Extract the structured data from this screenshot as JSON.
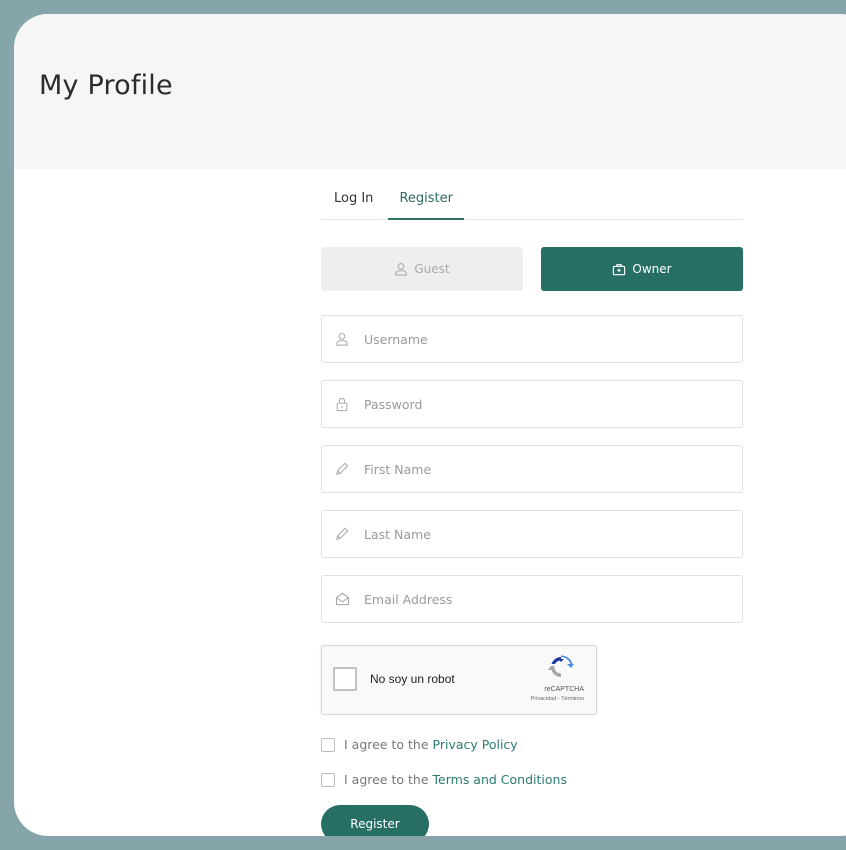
{
  "header": {
    "title": "My Profile"
  },
  "tabs": [
    {
      "label": "Log In",
      "active": false
    },
    {
      "label": "Register",
      "active": true
    }
  ],
  "roles": {
    "guest": {
      "label": "Guest",
      "icon": "user-icon"
    },
    "owner": {
      "label": "Owner",
      "icon": "briefcase-icon",
      "selected": true
    }
  },
  "fields": {
    "username": {
      "placeholder": "Username",
      "icon": "user-icon"
    },
    "password": {
      "placeholder": "Password",
      "icon": "lock-icon"
    },
    "first_name": {
      "placeholder": "First Name",
      "icon": "pencil-icon"
    },
    "last_name": {
      "placeholder": "Last Name",
      "icon": "pencil-icon"
    },
    "email": {
      "placeholder": "Email Address",
      "icon": "envelope-icon"
    }
  },
  "captcha": {
    "label": "No soy un robot",
    "brand": "reCAPTCHA",
    "links": "Privacidad - Términos"
  },
  "agreements": {
    "privacy_prefix": "I agree to the",
    "privacy_link": "Privacy Policy",
    "terms_prefix": "I agree to the",
    "terms_link": "Terms and Conditions"
  },
  "register_button": "Register",
  "colors": {
    "background": "#86a5aa",
    "accent": "#276f65",
    "link": "#2b7b72"
  }
}
